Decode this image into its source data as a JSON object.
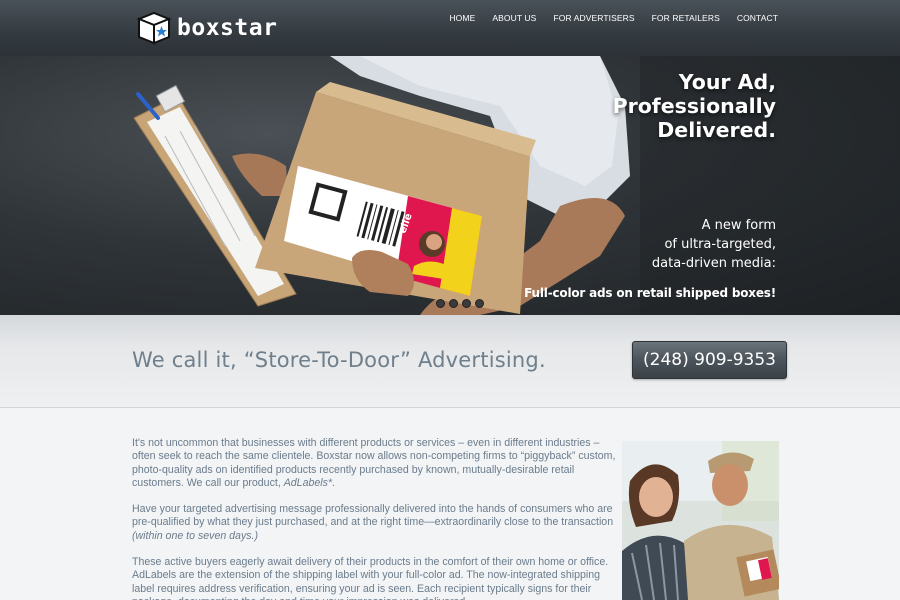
{
  "brand": {
    "name": "boxstar"
  },
  "nav": [
    {
      "label": "HOME"
    },
    {
      "label": "ABOUT US"
    },
    {
      "label": "FOR ADVERTISERS"
    },
    {
      "label": "FOR RETAILERS"
    },
    {
      "label": "CONTACT"
    }
  ],
  "hero": {
    "headline": [
      "Your Ad,",
      "Professionally",
      "Delivered."
    ],
    "subtext": [
      "A new form",
      "of ultra-targeted,",
      "data-driven media:"
    ],
    "cta": "Full-color ads on retail shipped boxes!",
    "slide_count": 4
  },
  "band": {
    "tagline": "We call it, “Store-To-Door” Advertising.",
    "phone": "(248) 909-9353"
  },
  "content": {
    "p1_text": "It's not uncommon that businesses with different products or services – even in different industries – often seek to reach the same clientele. Boxstar now allows non-competing firms to “piggyback” custom, photo-quality ads on identified products recently purchased by known, mutually-desirable retail customers. We call our product, ",
    "p1_em": "AdLabels*",
    "p1_end": ".",
    "p2_text": "Have your targeted advertising message professionally delivered into the hands of consumers who are pre-qualified by what they just purchased, and at the right time—extraordinarily close to the transaction ",
    "p2_em": "(within one to seven days.)",
    "p3_text": "These active buyers eagerly await delivery of their products in the comfort of their own home or office. AdLabels are the extension of the shipping label with your full-color ad. The now-integrated shipping label requires address verification, ensuring your ad is seen. Each recipient typically signs for their package, documenting the day and time your impression was delivered."
  },
  "colors": {
    "header_bg": "#353c42",
    "body_text": "#6b7c8d",
    "tagline_text": "#6f7f8b",
    "button_bg": "#4e565d",
    "label_accent": "#e0174f",
    "label_yellow": "#f3d21c"
  },
  "icons": {
    "logo": "box-star-icon"
  }
}
